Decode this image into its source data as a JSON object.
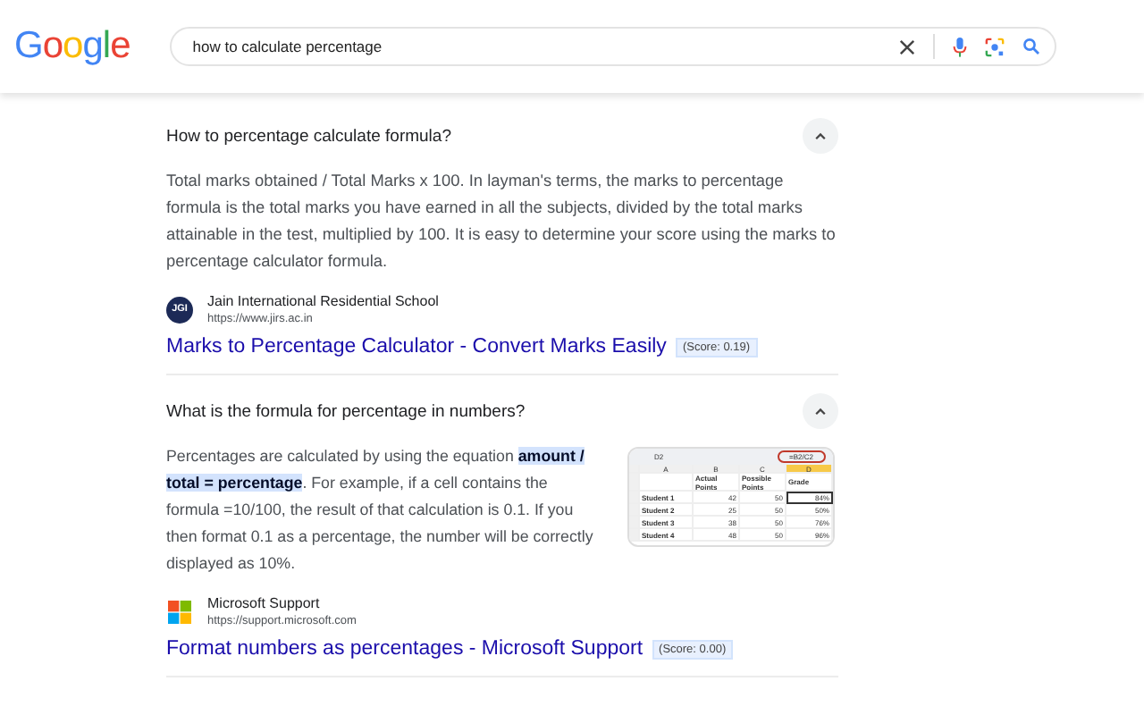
{
  "header": {
    "logo": "Google",
    "query": "how to calculate percentage"
  },
  "questions": [
    {
      "question": "How to percentage calculate formula?",
      "expanded": true,
      "answer": "Total marks obtained / Total Marks x 100. In layman's terms, the marks to percentage formula is the total marks you have earned in all the subjects, divided by the total marks attainable in the test, multiplied by 100. It is easy to determine your score using the marks to percentage calculator formula.",
      "source": {
        "kind": "jgi",
        "badge": "JGI",
        "name": "Jain International Residential School",
        "url": "https://www.jirs.ac.in"
      },
      "link": "Marks to Percentage Calculator - Convert Marks Easily",
      "score": "(Score: 0.19)"
    },
    {
      "question": "What is the formula for percentage in numbers?",
      "expanded": true,
      "answer_parts": [
        {
          "text": "Percentages are calculated by using the equation ",
          "highlight": false
        },
        {
          "text": "amount / total = percentage",
          "highlight": true
        },
        {
          "text": ". For example, if a cell contains the formula =10/100, the result of that calculation is 0.1. If you then format 0.1 as a percentage, the number will be correctly displayed as 10%.",
          "highlight": false
        }
      ],
      "thumbnail": {
        "cell_ref": "D2",
        "formula": "=B2/C2",
        "columns": [
          "A",
          "B",
          "C",
          "D"
        ],
        "headers": [
          "Actual Points",
          "Possible Points",
          "Grade"
        ],
        "rows": [
          [
            "Student 1",
            "42",
            "50",
            "84%"
          ],
          [
            "Student 2",
            "25",
            "50",
            "50%"
          ],
          [
            "Student 3",
            "38",
            "50",
            "76%"
          ],
          [
            "Student 4",
            "48",
            "50",
            "96%"
          ]
        ]
      },
      "source": {
        "kind": "ms",
        "name": "Microsoft Support",
        "url": "https://support.microsoft.com"
      },
      "link": "Format numbers as percentages - Microsoft Support",
      "score": "(Score: 0.00)"
    }
  ]
}
